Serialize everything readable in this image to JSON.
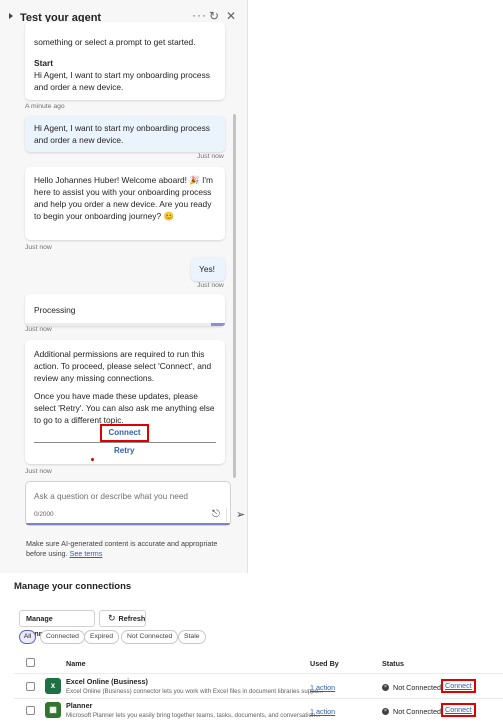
{
  "agent_panel": {
    "title": "Test your agent",
    "icons": {
      "more": "more-horizontal-icon",
      "refresh": "refresh-icon",
      "close": "close-icon",
      "collapse": "chevron-right-icon"
    },
    "intro_text": "something or select a prompt to get started.",
    "start_label": "Start",
    "start_text": "Hi Agent, I want to start my onboarding process and order a new device.",
    "intro_time": "A minute ago",
    "messages": [
      {
        "role": "user",
        "text": "Hi Agent, I want to start my onboarding process and order a new device.",
        "time": "Just now"
      },
      {
        "role": "bot",
        "text": "Hello Johannes Huber! Welcome aboard! 🎉 I'm here to assist you with your onboarding process and help you order a new device. Are you ready to begin your onboarding journey? 😊",
        "time": "Just now"
      },
      {
        "role": "user",
        "text": "Yes!",
        "time": "Just now"
      },
      {
        "role": "bot",
        "text": "Processing",
        "time": "Just now"
      }
    ],
    "permission_card": {
      "text1": "Additional permissions are required to run this action. To proceed, please select 'Connect', and review any missing connections.",
      "text2": "Once you have made these updates, please select 'Retry'. You can also ask me anything else to go to a different topic.",
      "connect_label": "Connect",
      "retry_label": "Retry",
      "time": "Just now"
    },
    "composer": {
      "placeholder": "Ask a question or describe what you need",
      "char_count": "0/2000",
      "icons": {
        "attach": "paperclip-icon",
        "send": "send-icon"
      }
    },
    "disclaimer": "Make sure AI-generated content is accurate and appropriate before using.",
    "terms_link": "See terms"
  },
  "connections": {
    "title": "Manage your connections",
    "manage_button": "Manage connections",
    "refresh_button": "Refresh",
    "filters": [
      {
        "label": "All",
        "active": true
      },
      {
        "label": "Connected",
        "active": false
      },
      {
        "label": "Expired",
        "active": false
      },
      {
        "label": "Not Connected",
        "active": false
      },
      {
        "label": "Stale",
        "active": false
      }
    ],
    "columns": {
      "name": "Name",
      "used_by": "Used By",
      "status": "Status"
    },
    "rows": [
      {
        "name": "Excel Online (Business)",
        "description": "Excel Online (Business) connector lets you work with Excel files in document libraries suppo...",
        "icon": "excel-icon",
        "used_by": "1 action",
        "status": "Not Connected",
        "connect_label": "Connect"
      },
      {
        "name": "Planner",
        "description": "Microsoft Planner lets you easily bring together teams, tasks, documents, and conversation...",
        "icon": "planner-icon",
        "used_by": "1 action",
        "status": "Not Connected",
        "connect_label": "Connect"
      }
    ]
  }
}
